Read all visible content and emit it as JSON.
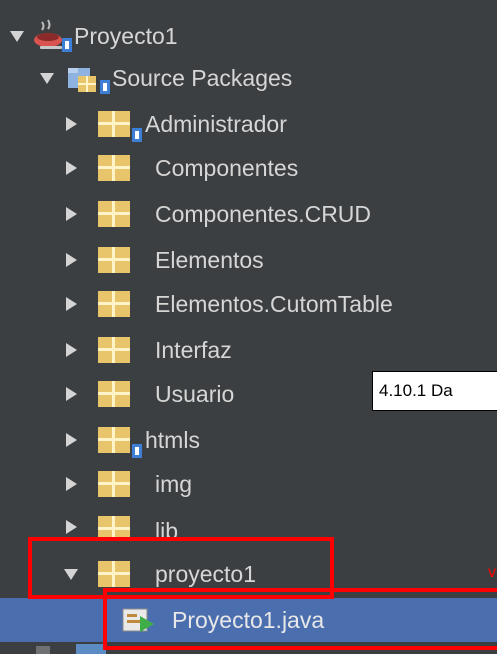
{
  "tree": {
    "project": "Proyecto1",
    "source_packages": "Source Packages",
    "packages": [
      "Administrador",
      "Componentes",
      "Componentes.CRUD",
      "Elementos",
      "Elementos.CutomTable",
      "Interfaz",
      "Usuario",
      "htmls",
      "img",
      "lib",
      "proyecto1"
    ],
    "selected_file": "Proyecto1.java"
  },
  "note": {
    "text": "4.10.1 Da"
  },
  "colors": {
    "background": "#3c3f41",
    "selection": "#4b6eaf",
    "package_yellow": "#e8c56b",
    "highlight_red": "#ff0000"
  },
  "icons": {
    "project": "coffee-cup-icon",
    "source_packages": "source-folder-icon",
    "package": "package-icon",
    "java_file": "java-class-icon"
  }
}
